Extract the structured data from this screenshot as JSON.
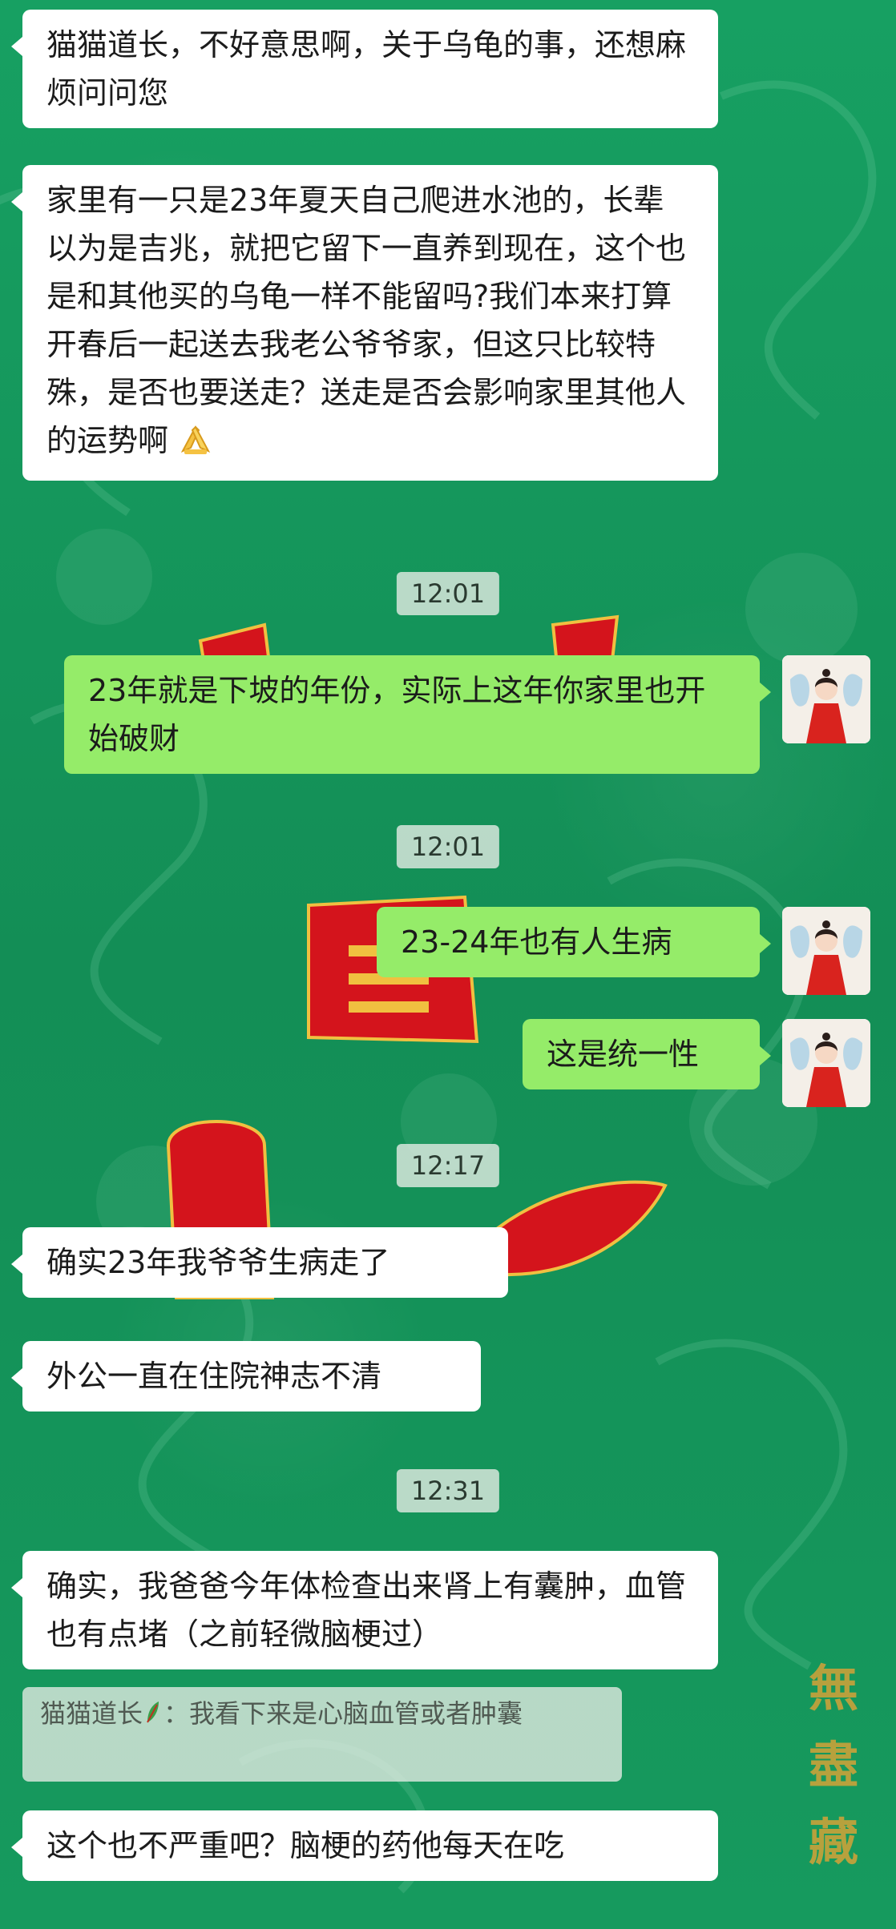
{
  "messages": [
    {
      "side": "left",
      "text": "猫猫道长，不好意思啊，关于乌龟的事，还想麻烦问问您"
    },
    {
      "side": "left",
      "text": "家里有一只是23年夏天自己爬进水池的，长辈以为是吉兆，就把它留下一直养到现在，这个也是和其他买的乌龟一样不能留吗?我们本来打算开春后一起送去我老公爷爷家，但这只比较特殊，是否也要送走？送走是否会影响家里其他人的运势啊",
      "emoji": "folded-hands-emoji"
    },
    {
      "side": "right",
      "text": "23年就是下坡的年份，实际上这年你家里也开始破财"
    },
    {
      "side": "right",
      "text": "23-24年也有人生病"
    },
    {
      "side": "right",
      "text": "这是统一性"
    },
    {
      "side": "left",
      "text": "确实23年我爷爷生病走了"
    },
    {
      "side": "left",
      "text": "外公一直在住院神志不清"
    },
    {
      "side": "left",
      "text": "确实，我爸爸今年体检查出来肾上有囊肿，血管也有点堵（之前轻微脑梗过）"
    },
    {
      "side": "left",
      "text": "这个也不严重吧？脑梗的药他每天在吃"
    }
  ],
  "timestamps": [
    "12:01",
    "12:01",
    "12:17",
    "12:31"
  ],
  "quote": {
    "name": "猫猫道长",
    "name_icon": "leaf-icon",
    "separator": "：",
    "text": "我看下来是心脑血管或者肿囊"
  },
  "watermark": "無盡藏",
  "colors": {
    "background": "#169a5e",
    "bubble_left": "#ffffff",
    "bubble_right": "#95ec69",
    "decoration_red": "#d4141c",
    "seal_gold": "#c9a23a"
  }
}
